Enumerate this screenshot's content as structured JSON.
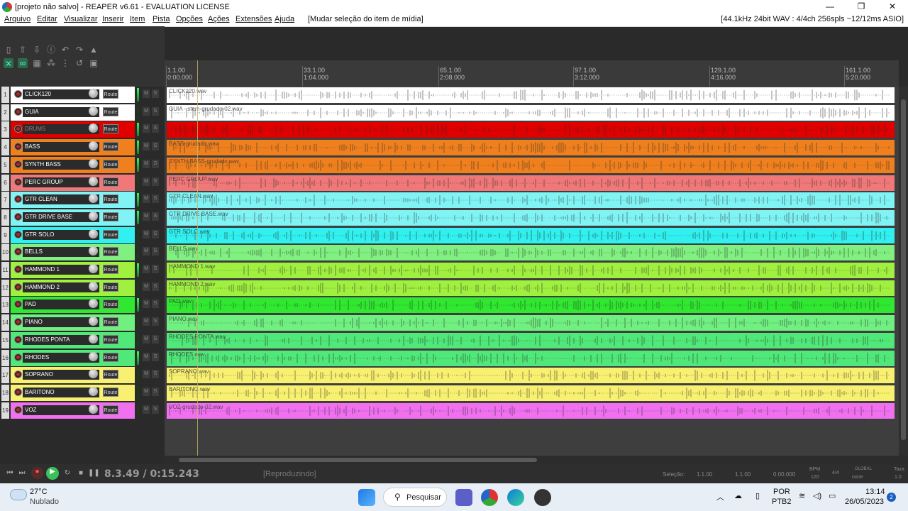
{
  "window": {
    "title": "[projeto não salvo] - REAPER v6.61 - EVALUATION LICENSE",
    "minimize": "—",
    "maximize": "❐",
    "close": "✕"
  },
  "menu": {
    "items": [
      "Arquivo",
      "Editar",
      "Visualizar",
      "Inserir",
      "Item",
      "Pista",
      "Opções",
      "Ações",
      "Extensões",
      "Ajuda"
    ],
    "last_action": "[Mudar seleção do item de mídia]",
    "audio_status": "[44.1kHz 24bit WAV : 4/4ch 256spls ~12/12ms ASIO]"
  },
  "ruler": {
    "markers": [
      {
        "measure": "1.1.00",
        "time": "0:00.000"
      },
      {
        "measure": "33.1.00",
        "time": "1:04.000"
      },
      {
        "measure": "65.1.00",
        "time": "2:08.000"
      },
      {
        "measure": "97.1.00",
        "time": "3:12.000"
      },
      {
        "measure": "129.1.00",
        "time": "4:16.000"
      },
      {
        "measure": "161.1.00",
        "time": "5:20.000"
      }
    ]
  },
  "tracks": [
    {
      "num": "1",
      "name": "CLICK120",
      "color": "#ffffff",
      "clip": "CLICK120.wav",
      "route": "Route",
      "mute": "M",
      "solo": "S",
      "meter": true
    },
    {
      "num": "2",
      "name": "GUIA",
      "color": "#ffffff",
      "clip": "GUIA - stem-grudado-02.wav",
      "route": "Route",
      "mute": "M",
      "solo": "S",
      "meter": false
    },
    {
      "num": "3",
      "name": "DRUMS",
      "color": "#e00000",
      "clip": "",
      "route": "Route",
      "mute": "M",
      "solo": "S",
      "meter": true
    },
    {
      "num": "4",
      "name": "BASS",
      "color": "#f0801e",
      "clip": "BASS-grudado.wav",
      "route": "Route",
      "mute": "M",
      "solo": "S",
      "meter": true
    },
    {
      "num": "5",
      "name": "SYNTH BASS",
      "color": "#f0801e",
      "clip": "SYNTH BASS-grudado.wav",
      "route": "Route",
      "mute": "M",
      "solo": "S",
      "meter": true
    },
    {
      "num": "6",
      "name": "PERC GROUP",
      "color": "#f07878",
      "clip": "PERC GROUP.wav",
      "route": "Route",
      "mute": "M",
      "solo": "S",
      "meter": false
    },
    {
      "num": "7",
      "name": "GTR CLEAN",
      "color": "#80f4f4",
      "clip": "GTR CLEAN.wav",
      "route": "Route",
      "mute": "M",
      "solo": "S",
      "meter": true
    },
    {
      "num": "8",
      "name": "GTR DRIVE BASE",
      "color": "#80f4f4",
      "clip": "GTR DRIVE BASE.wav",
      "route": "Route",
      "mute": "M",
      "solo": "S",
      "meter": true
    },
    {
      "num": "9",
      "name": "GTR SOLO",
      "color": "#30f0f0",
      "clip": "GTR SOLO.wav",
      "route": "Route",
      "mute": "M",
      "solo": "S",
      "meter": false
    },
    {
      "num": "10",
      "name": "BELLS",
      "color": "#80f080",
      "clip": "BELLS.wav",
      "route": "Route",
      "mute": "M",
      "solo": "S",
      "meter": false
    },
    {
      "num": "11",
      "name": "HAMMOND 1",
      "color": "#a0f040",
      "clip": "HAMMOND 1.wav",
      "route": "Route",
      "mute": "M",
      "solo": "S",
      "meter": true
    },
    {
      "num": "12",
      "name": "HAMMOND 2",
      "color": "#a0f040",
      "clip": "HAMMOND 2.wav",
      "route": "Route",
      "mute": "M",
      "solo": "S",
      "meter": false
    },
    {
      "num": "13",
      "name": "PAD",
      "color": "#30e830",
      "clip": "PAD.wav",
      "route": "Route",
      "mute": "M",
      "solo": "S",
      "meter": true
    },
    {
      "num": "14",
      "name": "PIANO",
      "color": "#70f080",
      "clip": "PIANO.wav",
      "route": "Route",
      "mute": "M",
      "solo": "S",
      "meter": false
    },
    {
      "num": "15",
      "name": "RHODES PONTA",
      "color": "#50e878",
      "clip": "RHODES PONTA.wav",
      "route": "Route",
      "mute": "M",
      "solo": "S",
      "meter": false
    },
    {
      "num": "16",
      "name": "RHODES",
      "color": "#50e878",
      "clip": "RHODES.wav",
      "route": "Route",
      "mute": "M",
      "solo": "S",
      "meter": true
    },
    {
      "num": "17",
      "name": "SOPRANO",
      "color": "#f8f070",
      "clip": "SOPRANO.wav",
      "route": "Route",
      "mute": "M",
      "solo": "S",
      "meter": false
    },
    {
      "num": "18",
      "name": "BARITONO",
      "color": "#f8f070",
      "clip": "BARITONO.wav",
      "route": "Route",
      "mute": "M",
      "solo": "S",
      "meter": false
    },
    {
      "num": "19",
      "name": "VOZ",
      "color": "#f070f0",
      "clip": "VOZ-grudado-02.wav",
      "route": "Route",
      "mute": "M",
      "solo": "S",
      "meter": false
    }
  ],
  "transport": {
    "position": "8.3.49 / 0:15.243",
    "state": "[Reproduzindo]",
    "selection_label": "Seleção:",
    "sel_start": "1.1.00",
    "sel_end": "1.1.00",
    "sel_len": "0.00.000",
    "bpm_label": "BPM",
    "bpm": "120",
    "timesig": "4/4",
    "global_label": "GLOBAL",
    "global_value": "none",
    "rate_label": "Taxa",
    "rate": "1.0"
  },
  "taskbar": {
    "temperature": "27°C",
    "weather": "Nublado",
    "search": "Pesquisar",
    "lang1": "POR",
    "lang2": "PTB2",
    "time": "13:14",
    "date": "26/05/2023",
    "notifications": "2"
  }
}
